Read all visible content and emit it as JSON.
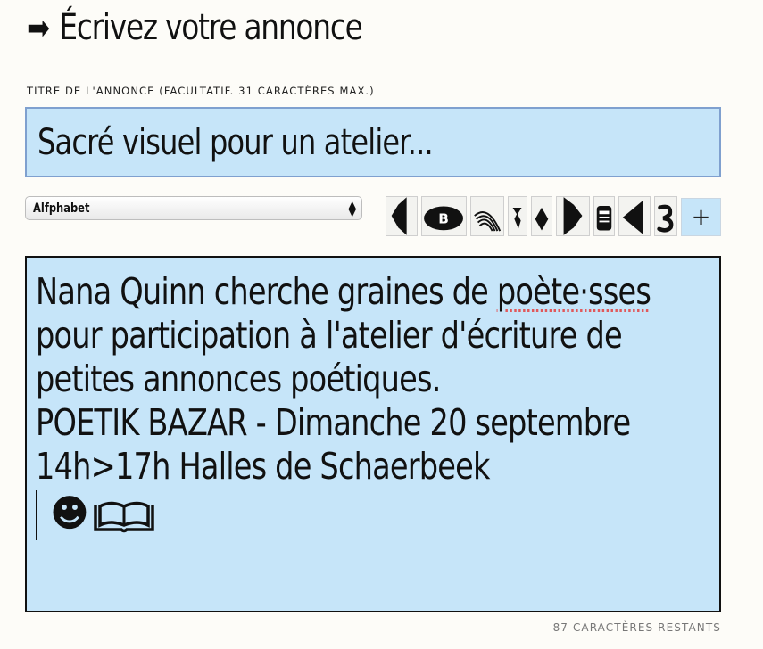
{
  "heading": {
    "arrow_icon": "➡",
    "title": "Écrivez votre annonce"
  },
  "title_field": {
    "label": "Titre de l'annonce (facultatif. 31 caractères max.)",
    "value": "Sacré visuel pour un atelier..."
  },
  "font_select": {
    "selected": "Alfphabet"
  },
  "glyph_palette": {
    "glyph_icons": [
      "half-lozenge-left-icon",
      "ellipse-b-icon",
      "arc-lines-icon",
      "sprout-icon",
      "diamond-icon",
      "half-lozenge-right-icon",
      "jar-icon",
      "arrowhead-left-icon",
      "numeral-3-icon"
    ],
    "add_label": "+"
  },
  "body_field": {
    "lines": [
      "Nana Quinn cherche graines de ",
      "poète·sses",
      "pour participation à l'atelier d'écriture de",
      "petites annonces poétiques.",
      "POETIK BAZAR - Dimanche 20 septembre",
      "14h>17h Halles de Schaerbeek"
    ],
    "emoji": [
      "☻",
      "book-icon"
    ]
  },
  "counter": "87 caractères restants",
  "colors": {
    "field_bg": "#c6e5f9",
    "title_border": "#7fa0cf",
    "spellcheck": "#e0595b"
  }
}
